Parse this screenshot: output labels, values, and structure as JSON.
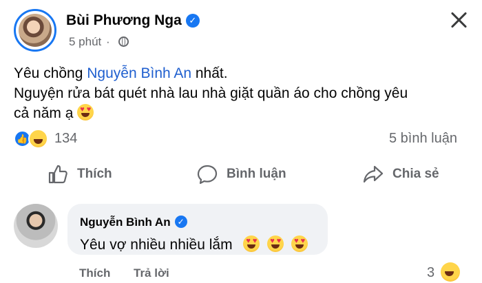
{
  "post": {
    "author": "Bùi Phương Nga",
    "time": "5 phút",
    "line1_prefix": "Yêu chồng ",
    "line1_mention": "Nguyễn Bình An",
    "line1_suffix": " nhất.",
    "line2": "Nguyện rửa bát quét nhà lau nhà giặt quần áo cho chồng yêu",
    "line3": "cả năm ạ "
  },
  "reactions": {
    "count": "134",
    "comments": "5 bình luận"
  },
  "actions": {
    "like": "Thích",
    "comment": "Bình luận",
    "share": "Chia sẻ"
  },
  "comment": {
    "author": "Nguyễn Bình An",
    "text": "Yêu vợ nhiều nhiều lắm",
    "like": "Thích",
    "reply": "Trả lời",
    "reaction_count": "3"
  },
  "colors": {
    "accent": "#1877f2",
    "muted": "#65676b",
    "bubble": "#f0f2f5"
  },
  "icons": [
    "verified-badge-icon",
    "globe-icon",
    "close-icon",
    "like-reaction-icon",
    "haha-reaction-icon",
    "thumbs-up-icon",
    "comment-icon",
    "share-icon",
    "heart-eyes-emoji"
  ]
}
